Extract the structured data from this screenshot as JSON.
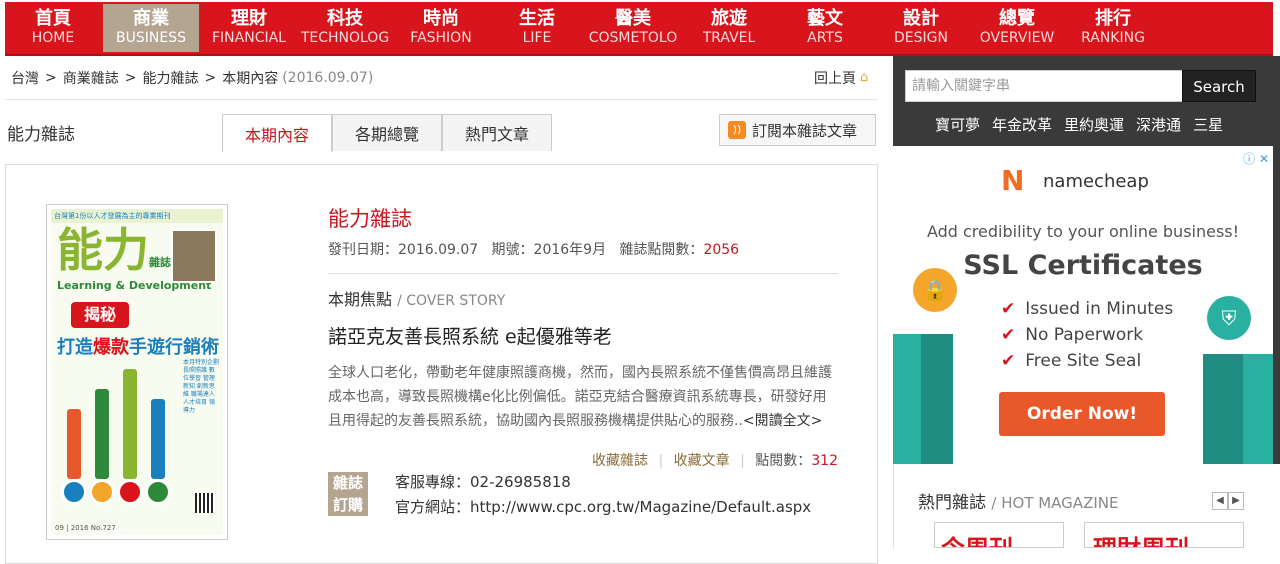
{
  "nav": [
    {
      "zh": "首頁",
      "en": "HOME"
    },
    {
      "zh": "商業",
      "en": "BUSINESS"
    },
    {
      "zh": "理財",
      "en": "FINANCIAL"
    },
    {
      "zh": "科技",
      "en": "TECHNOLOG"
    },
    {
      "zh": "時尚",
      "en": "FASHION"
    },
    {
      "zh": "生活",
      "en": "LIFE"
    },
    {
      "zh": "醫美",
      "en": "COSMETOLO"
    },
    {
      "zh": "旅遊",
      "en": "TRAVEL"
    },
    {
      "zh": "藝文",
      "en": "ARTS"
    },
    {
      "zh": "設計",
      "en": "DESIGN"
    },
    {
      "zh": "總覽",
      "en": "OVERVIEW"
    },
    {
      "zh": "排行",
      "en": "RANKING"
    }
  ],
  "breadcrumb": {
    "c1": "台灣",
    "c2": "商業雜誌",
    "c3": "能力雜誌",
    "c4": "本期內容",
    "date": "(2016.09.07)",
    "sep": ">",
    "back": "回上頁"
  },
  "section_label": "能力雜誌",
  "tabs": [
    "本期內容",
    "各期總覽",
    "熱門文章"
  ],
  "subscribe": {
    "label": "訂閱本雜誌文章",
    "rss": "rss"
  },
  "cover": {
    "top": "台灣第1份以人才發展為主的專業期刊",
    "title": "能力",
    "title_small": "雜誌",
    "subtitle": "Learning & Development",
    "badge": "揭秘",
    "head_a": "打造",
    "head_b": "爆款",
    "head_c": "手遊行銷術",
    "side": "本月特別企劃 長照照護 數位學習 管理新知 創新思維 職場達人 人才培育 領導力",
    "bottom": "09 | 2016 No.727"
  },
  "mag": {
    "name": "能力雜誌",
    "meta_a": "發刊日期：2016.09.07",
    "meta_b": "期號：2016年9月",
    "meta_c": "雜誌點閱數：",
    "views": "2056"
  },
  "focus": {
    "label": "本期焦點",
    "label_en": "/ COVER STORY"
  },
  "headline": "諾亞克友善長照系統 e起優雅等老",
  "summary": "全球人口老化，帶動老年健康照護商機，然而，國內長照系統不僅售價高昂且維護成本也高，導致長照機構e化比例偏低。諾亞克結合醫療資訊系統專長，研發好用且用得起的友善長照系統，協助國內長照服務機構提供貼心的服務..",
  "read_more": "<閱讀全文>",
  "actions": {
    "fav_mag": "收藏雜誌",
    "fav_article": "收藏文章",
    "clicks_label": "點閱數：",
    "clicks": "312",
    "divider": "|"
  },
  "order": {
    "line1": "雜誌",
    "line2": "訂購"
  },
  "contact": {
    "phone": "客服專線：02-26985818",
    "website": "官方網站：http://www.cpc.org.tw/Magazine/Default.aspx"
  },
  "search": {
    "placeholder": "請輸入關鍵字串",
    "button": "Search"
  },
  "hot_keywords": [
    "寶可夢",
    "年金改革",
    "里約奧運",
    "深港通",
    "三星"
  ],
  "ad": {
    "brand": "namecheap",
    "line1": "Add credibility to your online business!",
    "line2": "SSL Certificates",
    "items": [
      "Issued in Minutes",
      "No Paperwork",
      "Free Site Seal"
    ],
    "button": "Order Now!",
    "close": "ⓘ ✕"
  },
  "hot_mag": {
    "title": "熱門雜誌",
    "title_en": "/ HOT MAGAZINE",
    "thumb1": "今周刊",
    "thumb2": "理財周刊"
  }
}
